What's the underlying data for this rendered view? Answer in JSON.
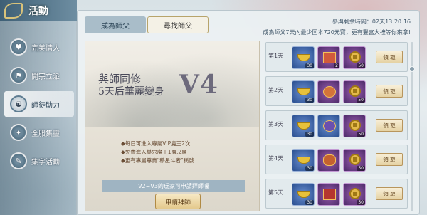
{
  "header": {
    "title": "活動"
  },
  "sidebar": {
    "items": [
      {
        "label": "完美情人",
        "icon": "heart-icon"
      },
      {
        "label": "開宗立派",
        "icon": "banner-icon"
      },
      {
        "label": "師徒助力",
        "icon": "mentor-icon",
        "active": true
      },
      {
        "label": "全服集靈",
        "icon": "spirit-icon"
      },
      {
        "label": "集字活動",
        "icon": "scroll-icon"
      }
    ]
  },
  "tabs": [
    "成為師父",
    "尋找師父"
  ],
  "info": {
    "remaining_label": "參與剩余時間：",
    "remaining_value": "02天13:20:16",
    "desc": "成為師父7天內最少回本720元寶，更有豐富大禮等你來拿!"
  },
  "promo": {
    "title_line1": "與師同修",
    "title_line2": "5天后華麗變身",
    "big": "V4",
    "bullets": [
      "◆每日可進入專屬VIP魔王2次",
      "◆免費進入巢穴魔王1層,2層",
      "◆更有專屬尊貴\"移星斗者\"稱號"
    ],
    "note": "V2~V3的玩家可申請拜師喔",
    "apply_button": "申請拜師"
  },
  "rows": [
    {
      "day": "第1天",
      "items": [
        {
          "count": "30"
        },
        {
          "count": "2"
        },
        {
          "count": "50"
        }
      ],
      "button": "領 取"
    },
    {
      "day": "第2天",
      "items": [
        {
          "count": "30"
        },
        {
          "count": ""
        },
        {
          "count": "50"
        }
      ],
      "button": "領 取"
    },
    {
      "day": "第3天",
      "items": [
        {
          "count": "30"
        },
        {
          "count": ""
        },
        {
          "count": "50"
        }
      ],
      "button": "領 取"
    },
    {
      "day": "第4天",
      "items": [
        {
          "count": "30"
        },
        {
          "count": ""
        },
        {
          "count": "50"
        }
      ],
      "button": "領 取"
    },
    {
      "day": "第5天",
      "items": [
        {
          "count": "30"
        },
        {
          "count": ""
        },
        {
          "count": "50"
        }
      ],
      "button": "領 取"
    }
  ],
  "colors": {
    "accent_red": "#c43a2f",
    "tab_active": "#f4f1e6",
    "tab_inactive": "#a9bdc9"
  }
}
